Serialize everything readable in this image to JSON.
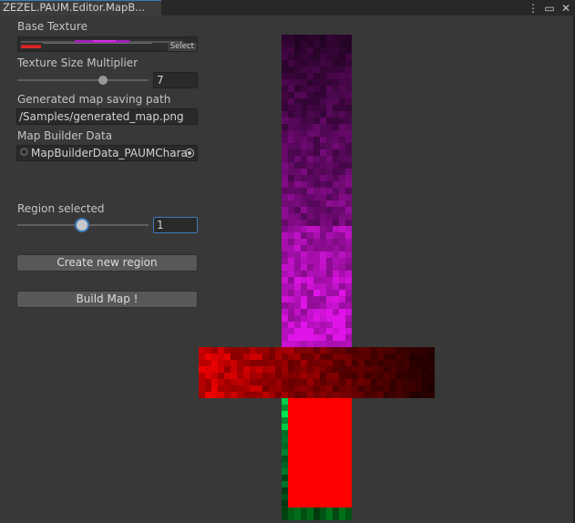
{
  "window": {
    "tab_title": "ZEZEL.PAUM.Editor.MapB...",
    "icons": [
      "kebab-menu-icon",
      "maximize-icon",
      "close-icon"
    ]
  },
  "base_texture": {
    "label": "Base Texture",
    "select_label": "Select"
  },
  "texture_size": {
    "label": "Texture Size Multiplier",
    "value": "7",
    "slider_fraction": 0.64
  },
  "save_path": {
    "label": "Generated map saving path",
    "value": "/Samples/generated_map.png"
  },
  "map_builder_data": {
    "label": "Map Builder Data",
    "value": "MapBuilderData_PAUMChara"
  },
  "region": {
    "label": "Region selected",
    "value": "1",
    "slider_fraction": 0.5
  },
  "buttons": {
    "create_region": "Create new region",
    "build_map": "Build Map !"
  },
  "colors": {
    "accent": "#3a79bb",
    "region_purple": "#e028e8",
    "region_red": "#ff0000",
    "region_green": "#00ff5a"
  }
}
